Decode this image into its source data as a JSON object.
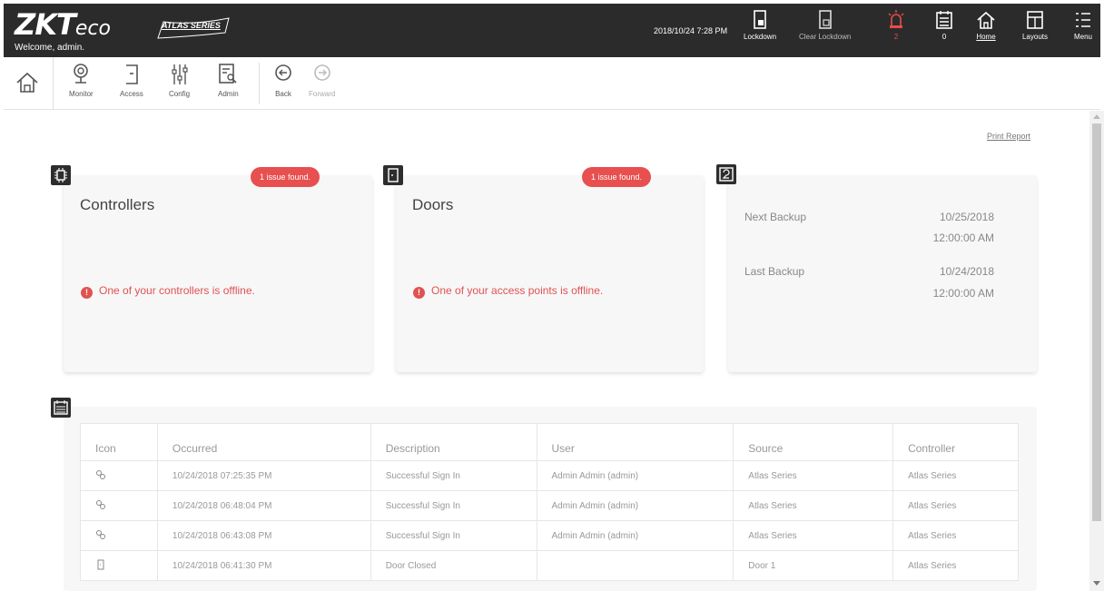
{
  "header": {
    "logo_text": "ZKT",
    "logo_suffix": "eco",
    "welcome": "Welcome, admin.",
    "series_badge": "ATLAS SERIES",
    "datetime": "2018/10/24 7:28 PM",
    "buttons": [
      {
        "label": "Lockdown"
      },
      {
        "label": "Clear Lockdown"
      },
      {
        "label": "2"
      },
      {
        "label": "0"
      },
      {
        "label": "Home"
      },
      {
        "label": "Layouts"
      },
      {
        "label": "Menu"
      }
    ]
  },
  "nav": {
    "items": [
      {
        "label": "Monitor"
      },
      {
        "label": "Access"
      },
      {
        "label": "Config"
      },
      {
        "label": "Admin"
      },
      {
        "label": "Back"
      },
      {
        "label": "Forward"
      }
    ]
  },
  "print_report": "Print Report",
  "controllers": {
    "issue": "1 issue found.",
    "title": "Controllers",
    "message": "One of your controllers is offline."
  },
  "doors": {
    "issue": "1 issue found.",
    "title": "Doors",
    "message": "One of your access points is offline."
  },
  "backup": {
    "next_label": "Next Backup",
    "next_date": "10/25/2018",
    "next_time": "12:00:00 AM",
    "last_label": "Last Backup",
    "last_date": "10/24/2018",
    "last_time": "12:00:00 AM"
  },
  "events": {
    "columns": [
      "Icon",
      "Occurred",
      "Description",
      "User",
      "Source",
      "Controller"
    ],
    "rows": [
      {
        "icon": "users-icon",
        "occurred": "10/24/2018 07:25:35 PM",
        "description": "Successful Sign In",
        "user": "Admin Admin (admin)",
        "source": "Atlas Series",
        "controller": "Atlas Series"
      },
      {
        "icon": "users-icon",
        "occurred": "10/24/2018 06:48:04 PM",
        "description": "Successful Sign In",
        "user": "Admin Admin (admin)",
        "source": "Atlas Series",
        "controller": "Atlas Series"
      },
      {
        "icon": "users-icon",
        "occurred": "10/24/2018 06:43:08 PM",
        "description": "Successful Sign In",
        "user": "Admin Admin (admin)",
        "source": "Atlas Series",
        "controller": "Atlas Series"
      },
      {
        "icon": "door-icon",
        "occurred": "10/24/2018 06:41:30 PM",
        "description": "Door Closed",
        "user": "",
        "source": "Door 1",
        "controller": "Atlas Series"
      }
    ]
  },
  "colors": {
    "header_bg": "#2b2b2b",
    "alert": "#e84f4f",
    "card_bg": "#f7f7f7"
  }
}
